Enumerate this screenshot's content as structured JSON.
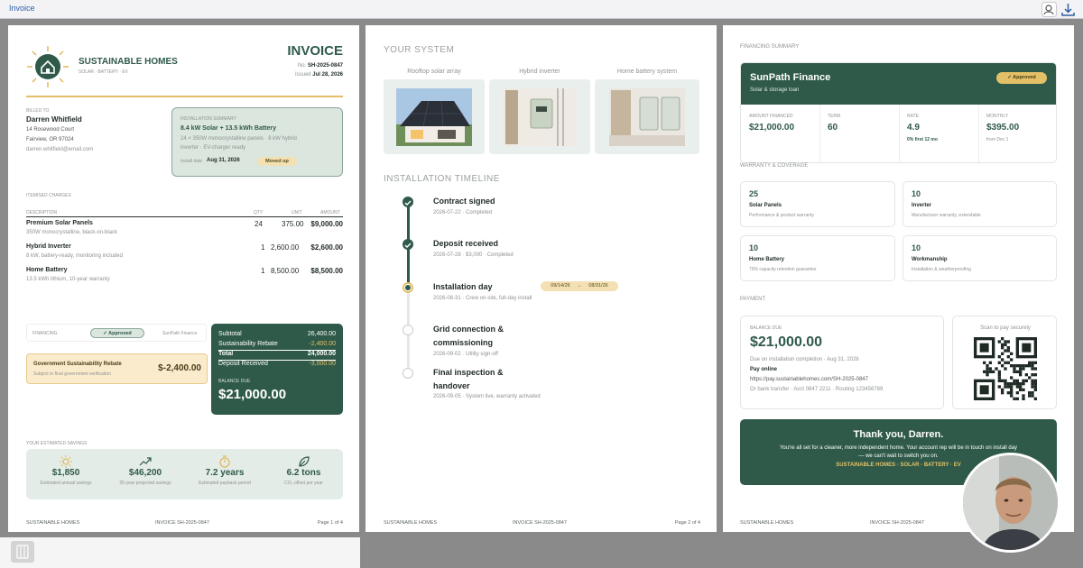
{
  "app": {
    "title": "Invoice"
  },
  "toolbar": {
    "icons": [
      "collaborate-icon",
      "download-icon"
    ]
  },
  "page1": {
    "brand": {
      "name": "SUSTAINABLE HOMES",
      "tagline": "SOLAR · BATTERY · EV"
    },
    "invoice": {
      "title": "INVOICE",
      "no_label": "No.",
      "no": "SH-2025-0847",
      "issued_label": "Issued",
      "issued": "Jul 28, 2026"
    },
    "billed": {
      "label": "BILLED TO",
      "name": "Darren Whitfield",
      "line1": "14 Rosewood Court",
      "line2": "Fairview, OR 97024",
      "email": "darren.whitfield@email.com"
    },
    "install": {
      "label": "INSTALLATION SUMMARY",
      "title": "8.4 kW Solar + 13.5 kWh Battery",
      "desc1": "24 × 350W monocrystalline panels · 8 kW hybrid",
      "desc2": "inverter · EV-charger ready",
      "date_label": "Install date",
      "date": "Aug 31, 2026",
      "badge": "Moved up"
    },
    "charges": {
      "label": "ITEMISED CHARGES",
      "headers": [
        "DESCRIPTION",
        "QTY",
        "UNIT",
        "AMOUNT"
      ],
      "rows": [
        {
          "name": "Premium Solar Panels",
          "desc": "350W monocrystalline, black-on-black",
          "qty": "24",
          "unit": "375.00",
          "amount": "$9,000.00"
        },
        {
          "name": "Hybrid Inverter",
          "desc": "8 kW, battery-ready, monitoring included",
          "qty": "1",
          "unit": "2,600.00",
          "amount": "$2,600.00"
        },
        {
          "name": "Home Battery",
          "desc": "13.5 kWh lithium, 10-year warranty",
          "qty": "1",
          "unit": "8,500.00",
          "amount": "$8,500.00"
        }
      ]
    },
    "financing": {
      "label": "FINANCING",
      "badge": "Approved",
      "provider": "SunPath Finance"
    },
    "rebate": {
      "title": "Government Sustainability Rebate",
      "sub": "Subject to final government verification",
      "amount": "$-2,400.00"
    },
    "totals": {
      "rows": [
        {
          "label": "Subtotal",
          "value": "26,400.00"
        },
        {
          "label": "Sustainability Rebate",
          "value": "-2,400.00"
        },
        {
          "label": "Total",
          "value": "24,000.00"
        },
        {
          "label": "Deposit Received",
          "value": "-3,000.00"
        }
      ],
      "due_label": "BALANCE DUE",
      "due": "$21,000.00"
    },
    "savings": {
      "label": "YOUR ESTIMATED SAVINGS",
      "items": [
        {
          "icon": "sun-icon",
          "value": "$1,850",
          "label": "Estimated annual savings"
        },
        {
          "icon": "trend-up-icon",
          "value": "$46,200",
          "label": "25-year projected savings"
        },
        {
          "icon": "timer-icon",
          "value": "7.2 years",
          "label": "Estimated payback period"
        },
        {
          "icon": "leaf-icon",
          "value": "6.2 tons",
          "label": "CO₂ offset per year"
        }
      ]
    },
    "footer": {
      "left": "SUSTAINABLE HOMES",
      "center": "INVOICE SH-2025-0847",
      "right": "Page 1 of 4"
    }
  },
  "page2": {
    "system_title": "YOUR SYSTEM",
    "system": [
      {
        "label": "Rooftop solar array"
      },
      {
        "label": "Hybrid inverter"
      },
      {
        "label": "Home battery system"
      }
    ],
    "timeline_title": "INSTALLATION TIMELINE",
    "steps": [
      {
        "title": "Contract signed",
        "title2": "",
        "meta": "2026-07-22 · Completed",
        "state": "done"
      },
      {
        "title": "Deposit received",
        "title2": "",
        "meta": "2026-07-28 · $3,000 · Completed",
        "state": "done"
      },
      {
        "title": "Installation day",
        "title2": "",
        "meta": "2026-08-31 · Crew on-site, full-day install",
        "state": "current"
      },
      {
        "title": "Grid connection &",
        "title2": "commissioning",
        "meta": "2026-09-02 · Utility sign-off",
        "state": "todo"
      },
      {
        "title": "Final inspection &",
        "title2": "handover",
        "meta": "2026-09-05 · System live, warranty activated",
        "state": "todo"
      }
    ],
    "reschedule": {
      "from": "09/14/26",
      "to": "08/31/26"
    },
    "footer": {
      "left": "SUSTAINABLE HOMES",
      "center": "INVOICE SH-2025-0847",
      "right": "Page 2 of 4"
    }
  },
  "page3": {
    "fin_label": "FINANCING SUMMARY",
    "fin": {
      "name": "SunPath Finance",
      "sub": "Solar & storage loan",
      "badge": "Approved",
      "stats": [
        {
          "label": "AMOUNT FINANCED",
          "value": "$21,000.00",
          "sub": ""
        },
        {
          "label": "TERM",
          "value": "60",
          "sub": ""
        },
        {
          "label": "RATE",
          "value": "4.9",
          "sub": "0% first 12 mo"
        },
        {
          "label": "MONTHLY",
          "value": "$395.00",
          "sub": "from Dec 1"
        }
      ]
    },
    "warranty_label": "WARRANTY & COVERAGE",
    "warranty": [
      {
        "years": "25",
        "name": "Solar Panels",
        "desc": "Performance & product warranty"
      },
      {
        "years": "10",
        "name": "Inverter",
        "desc": "Manufacturer warranty, extendable"
      },
      {
        "years": "10",
        "name": "Home Battery",
        "desc": "70% capacity retention guarantee"
      },
      {
        "years": "10",
        "name": "Workmanship",
        "desc": "Installation & weatherproofing"
      }
    ],
    "payment_label": "PAYMENT",
    "payment": {
      "due_label": "BALANCE DUE",
      "due": "$21,000.00",
      "due_note": "Due on installation completion · Aug 31, 2026",
      "online_label": "Pay online",
      "url": "https://pay.sustainablehomes.com/SH-2025-0847",
      "bank": "Or bank transfer · Acct 0847 2211 · Routing 123456789",
      "qr_label": "Scan to pay securely"
    },
    "thanks": {
      "title": "Thank you, Darren.",
      "line1": "You're all set for a cleaner, more independent home. Your account rep will be in touch on install day",
      "line2": "— we can't wait to switch you on.",
      "brand": "SUSTAINABLE HOMES · SOLAR · BATTERY · EV"
    },
    "footer": {
      "left": "SUSTAINABLE HOMES",
      "center": "INVOICE SH-2025-0847"
    }
  },
  "colors": {
    "brand_green": "#2f5a49",
    "gold": "#e3c068",
    "rebate_bg": "#fbebcd",
    "install_bg": "#dbe6df"
  }
}
